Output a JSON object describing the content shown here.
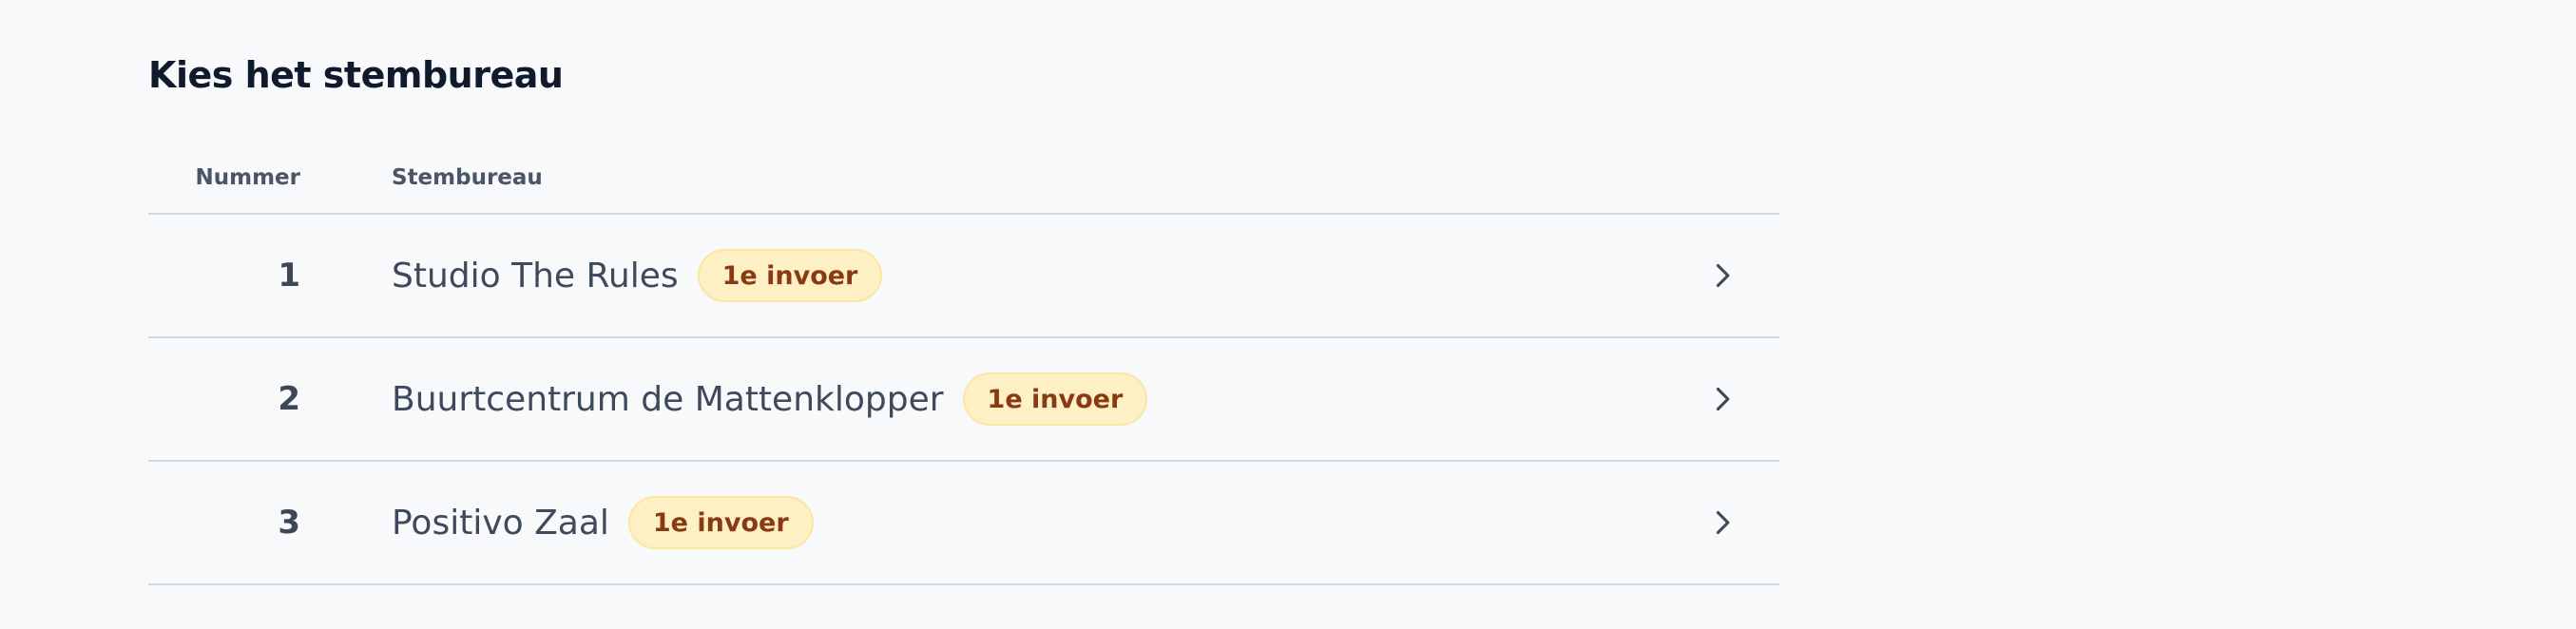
{
  "page": {
    "title": "Kies het stembureau"
  },
  "table": {
    "headers": {
      "number": "Nummer",
      "name": "Stembureau"
    },
    "rows": [
      {
        "number": "1",
        "name": "Studio The Rules",
        "badge": "1e invoer",
        "icon": "chevron-right-icon"
      },
      {
        "number": "2",
        "name": "Buurtcentrum de Mattenklopper",
        "badge": "1e invoer",
        "icon": "chevron-right-icon"
      },
      {
        "number": "3",
        "name": "Positivo Zaal",
        "badge": "1e invoer",
        "icon": "chevron-right-icon"
      }
    ]
  },
  "colors": {
    "background": "#f8f9fb",
    "title": "#0f1a2c",
    "badge_bg": "#fdf0c5",
    "badge_text": "#8a3a12",
    "divider": "#d4d8df"
  }
}
